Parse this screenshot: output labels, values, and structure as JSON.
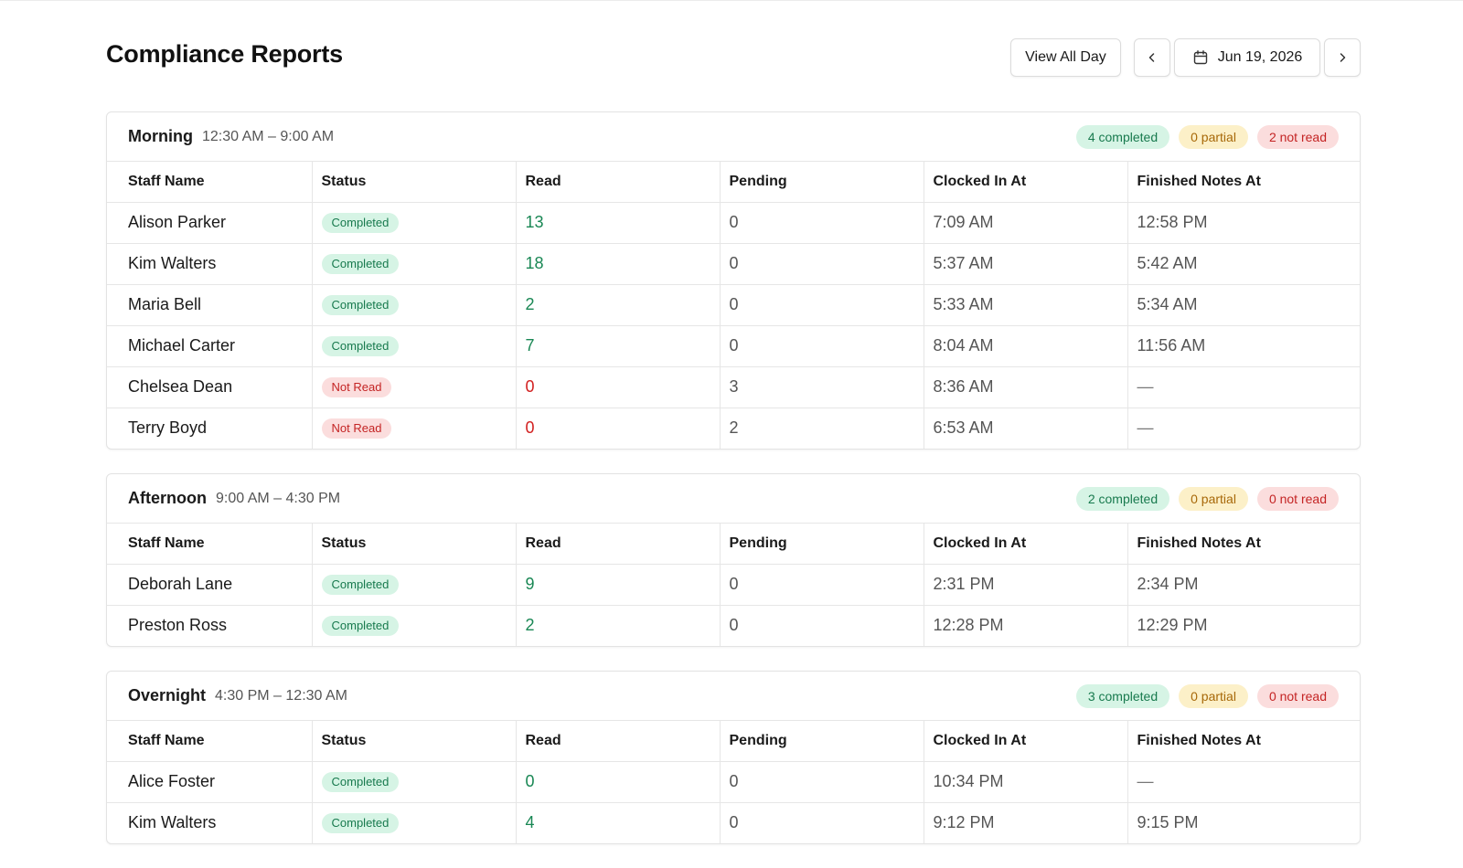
{
  "page": {
    "title": "Compliance Reports"
  },
  "controls": {
    "view_all_label": "View All Day",
    "date_label": "Jun 19, 2026",
    "prev_icon": "chevron-left-icon",
    "next_icon": "chevron-right-icon",
    "calendar_icon": "calendar-icon"
  },
  "colors": {
    "completed_bg": "#d6f4e5",
    "completed_text": "#187a4e",
    "partial_bg": "#fcf0c8",
    "partial_text": "#a76808",
    "notread_bg": "#fbdddd",
    "notread_text": "#c42424",
    "read_good": "#198754",
    "read_bad": "#d21f1f"
  },
  "columns": [
    "Staff Name",
    "Status",
    "Read",
    "Pending",
    "Clocked In At",
    "Finished Notes At"
  ],
  "sections": [
    {
      "name": "Morning",
      "time": "12:30 AM – 9:00 AM",
      "completed": "4 completed",
      "partial": "0 partial",
      "not_read": "2 not read",
      "rows": [
        {
          "name": "Alison Parker",
          "status": "Completed",
          "read": "13",
          "pending": "0",
          "clocked_in": "7:09 AM",
          "finished": "12:58 PM"
        },
        {
          "name": "Kim Walters",
          "status": "Completed",
          "read": "18",
          "pending": "0",
          "clocked_in": "5:37 AM",
          "finished": "5:42 AM"
        },
        {
          "name": "Maria Bell",
          "status": "Completed",
          "read": "2",
          "pending": "0",
          "clocked_in": "5:33 AM",
          "finished": "5:34 AM"
        },
        {
          "name": "Michael Carter",
          "status": "Completed",
          "read": "7",
          "pending": "0",
          "clocked_in": "8:04 AM",
          "finished": "11:56 AM"
        },
        {
          "name": "Chelsea Dean",
          "status": "Not Read",
          "read": "0",
          "pending": "3",
          "clocked_in": "8:36 AM",
          "finished": "—"
        },
        {
          "name": "Terry Boyd",
          "status": "Not Read",
          "read": "0",
          "pending": "2",
          "clocked_in": "6:53 AM",
          "finished": "—"
        }
      ]
    },
    {
      "name": "Afternoon",
      "time": "9:00 AM – 4:30 PM",
      "completed": "2 completed",
      "partial": "0 partial",
      "not_read": "0 not read",
      "rows": [
        {
          "name": "Deborah Lane",
          "status": "Completed",
          "read": "9",
          "pending": "0",
          "clocked_in": "2:31 PM",
          "finished": "2:34 PM"
        },
        {
          "name": "Preston Ross",
          "status": "Completed",
          "read": "2",
          "pending": "0",
          "clocked_in": "12:28 PM",
          "finished": "12:29 PM"
        }
      ]
    },
    {
      "name": "Overnight",
      "time": "4:30 PM – 12:30 AM",
      "completed": "3 completed",
      "partial": "0 partial",
      "not_read": "0 not read",
      "rows": [
        {
          "name": "Alice Foster",
          "status": "Completed",
          "read": "0",
          "pending": "0",
          "clocked_in": "10:34 PM",
          "finished": "—"
        },
        {
          "name": "Kim Walters",
          "status": "Completed",
          "read": "4",
          "pending": "0",
          "clocked_in": "9:12 PM",
          "finished": "9:15 PM"
        }
      ]
    }
  ]
}
